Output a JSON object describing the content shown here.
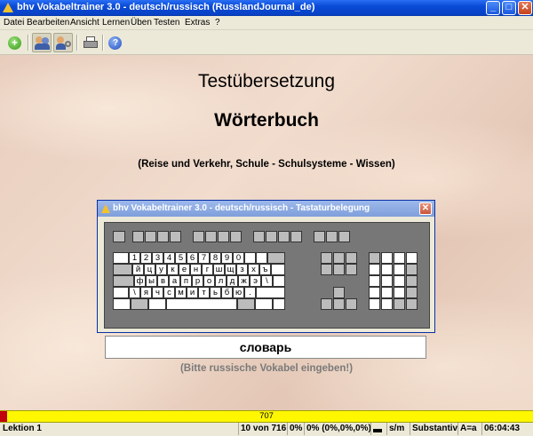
{
  "window": {
    "title": "bhv Vokabeltrainer 3.0 - deutsch/russisch (RusslandJournal_de)",
    "buttons": {
      "minimize": "_",
      "maximize": "□",
      "close": "✕"
    }
  },
  "menu": [
    "Datei",
    "Bearbeiten",
    "Ansicht",
    "Lernen",
    "Üben",
    "Testen",
    "Extras",
    "?"
  ],
  "toolbar": {
    "buttons": [
      "add-icon",
      "users-icon",
      "users-settings-icon",
      "print-icon",
      "help-icon"
    ],
    "help_label": "?"
  },
  "main": {
    "heading": "Testübersetzung",
    "subheading": "Wörterbuch",
    "categories": "(Reise und Verkehr, Schule - Schulsysteme - Wissen)",
    "answer_value": "словарь",
    "hint": "(Bitte russische Vokabel eingeben!)"
  },
  "keyboard_dialog": {
    "title": "bhv Vokabeltrainer 3.0 - deutsch/russisch - Tastaturbelegung",
    "close": "✕",
    "row_numbers": [
      "1",
      "2",
      "3",
      "4",
      "5",
      "6",
      "7",
      "8",
      "9",
      "0"
    ],
    "row_upper": [
      "й",
      "ц",
      "у",
      "к",
      "е",
      "н",
      "г",
      "ш",
      "щ",
      "з",
      "х",
      "ъ"
    ],
    "row_home": [
      "ф",
      "ы",
      "в",
      "а",
      "п",
      "р",
      "о",
      "л",
      "д",
      "ж",
      "э",
      "\\"
    ],
    "row_lower": [
      "\\",
      "я",
      "ч",
      "с",
      "м",
      "и",
      "т",
      "ь",
      "б",
      "ю",
      "."
    ]
  },
  "progress": {
    "value": "707",
    "fraction": 0.014
  },
  "status": {
    "lesson": "Lektion 1",
    "counter": "10 von 716",
    "pct1": "0%",
    "pct2": "0% (0%,0%,0%)",
    "mode": "s/m",
    "wordtype": "Substantiv",
    "case": "A=a",
    "time": "06:04:43"
  },
  "colors": {
    "titlebar": "#0a4ad6",
    "progress": "#fff700",
    "progress_mark": "#c0000c"
  }
}
